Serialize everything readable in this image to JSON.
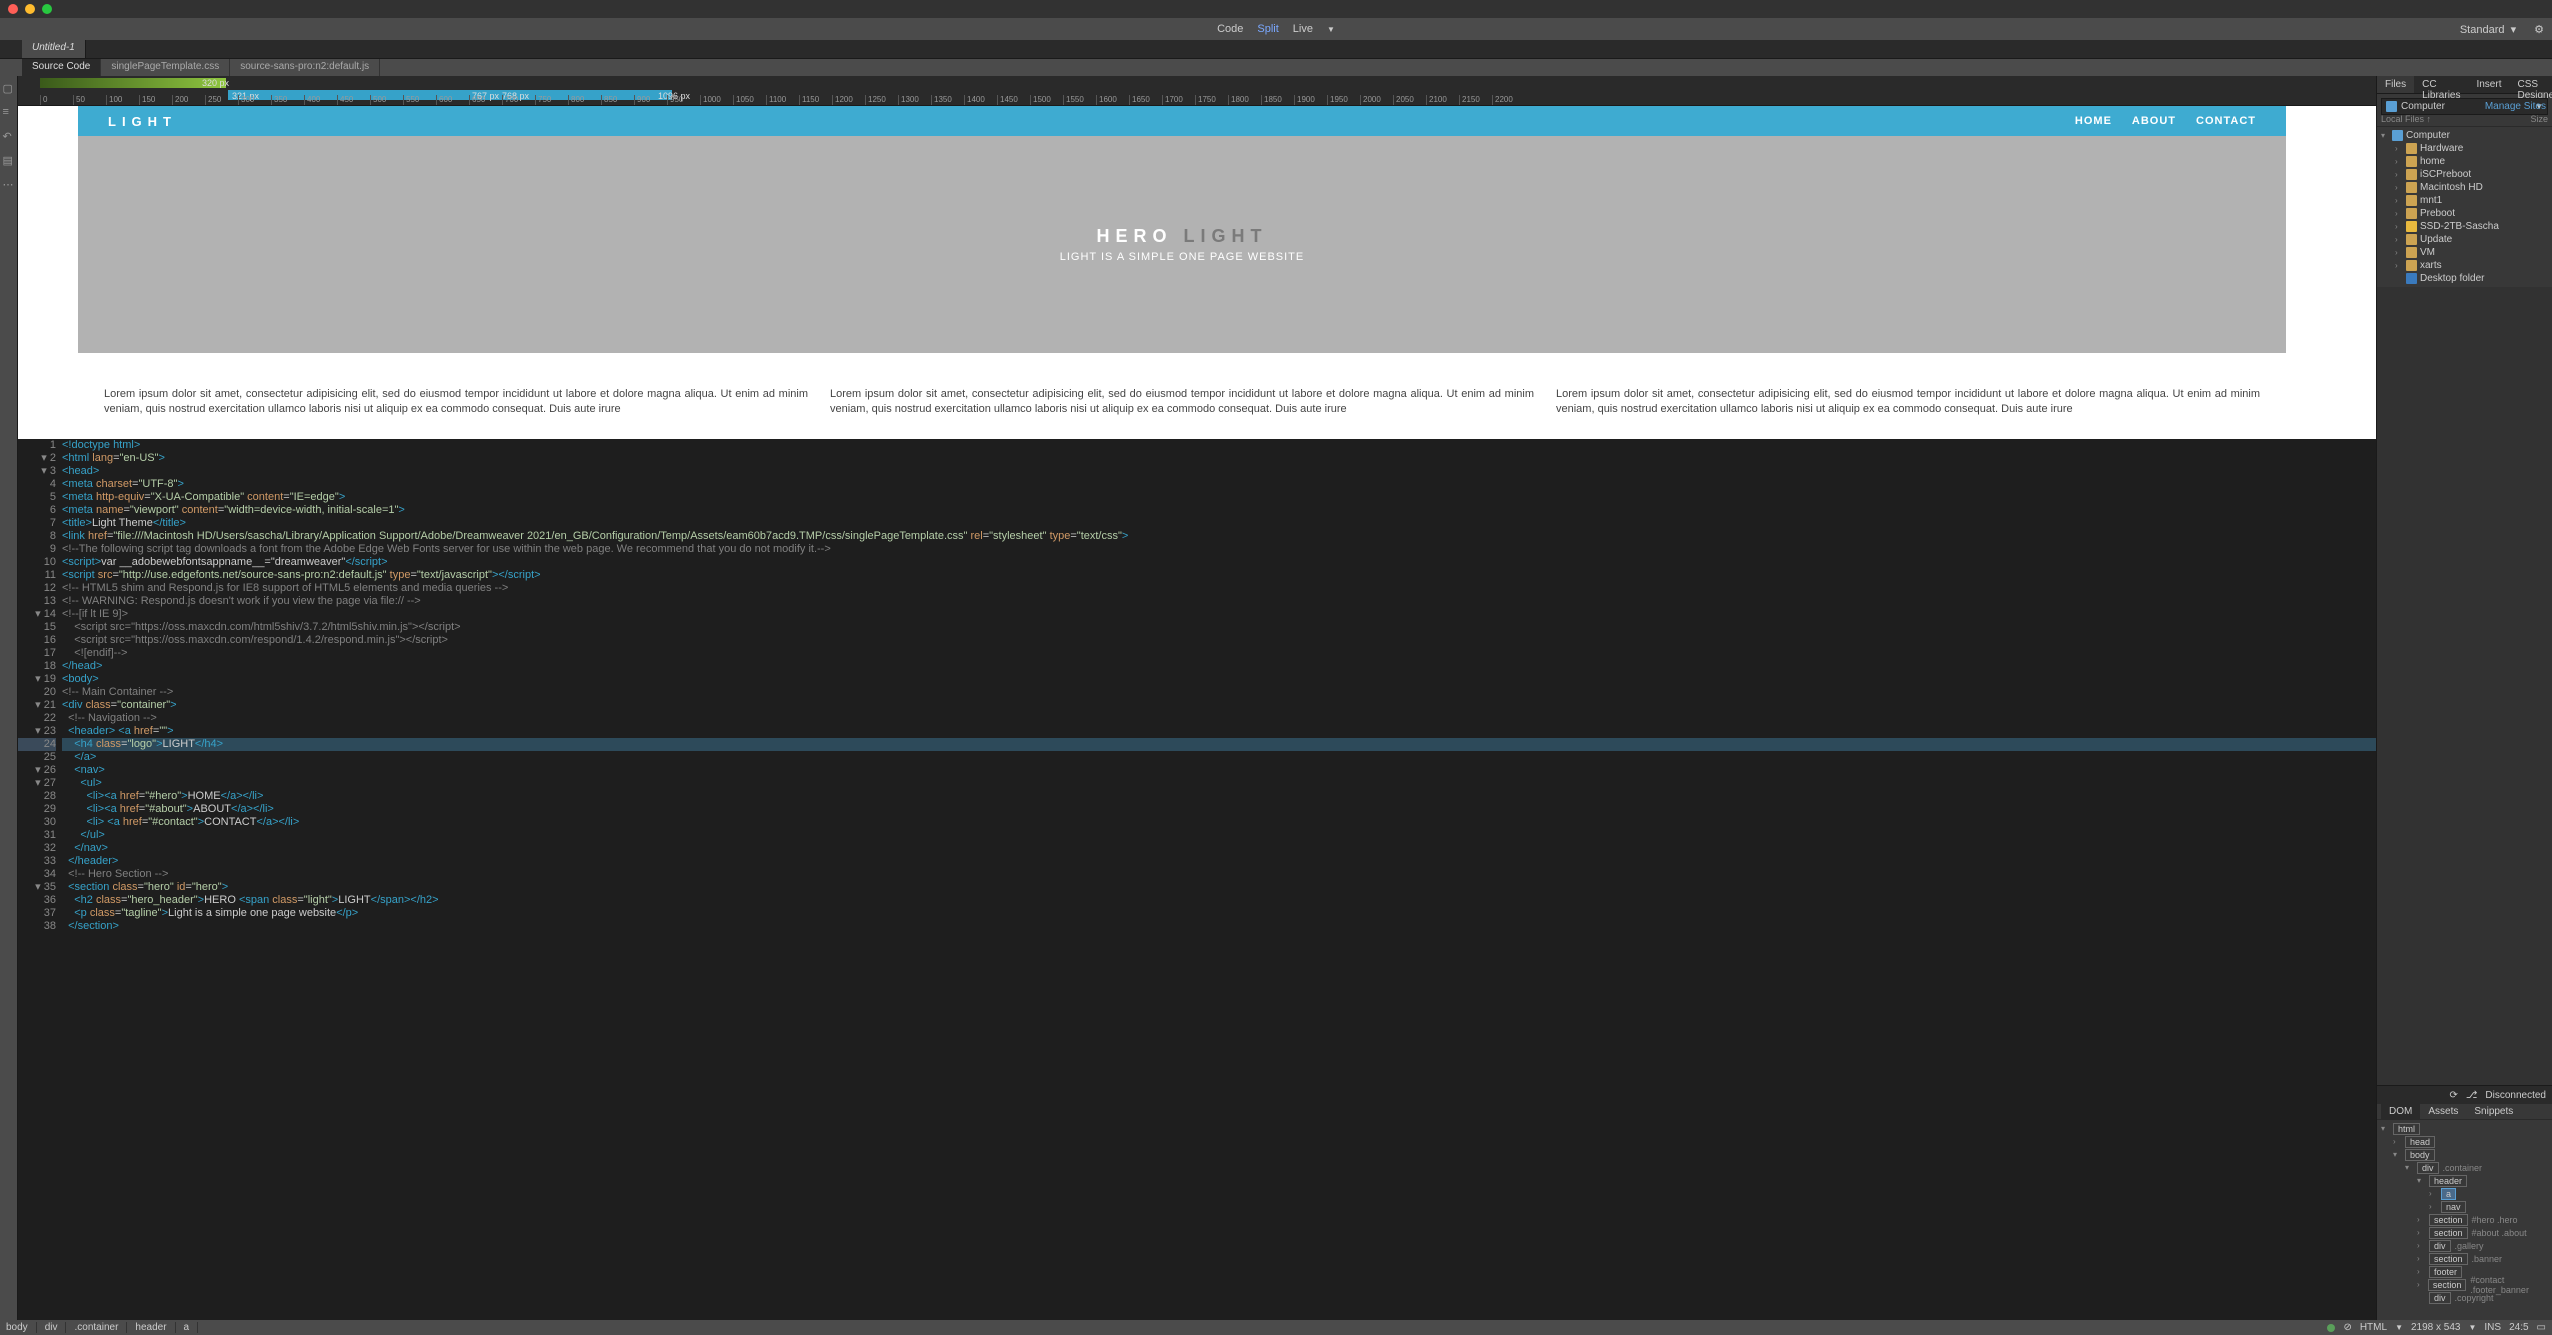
{
  "titlebar": {
    "view_modes": [
      "Code",
      "Split",
      "Live"
    ],
    "active_mode": "Split",
    "layout_label": "Standard"
  },
  "docTabs": [
    "Untitled-1"
  ],
  "fileTabs": [
    "Source Code",
    "singlePageTemplate.css",
    "source-sans-pro:n2:default.js"
  ],
  "rulerStrip": {
    "green_label": "320 px",
    "blue_start": "321 px",
    "blue_labels": [
      "767 px",
      "768 px"
    ],
    "blue_end": "1096 px"
  },
  "ruler_ticks": [
    "0",
    "50",
    "100",
    "150",
    "200",
    "250",
    "300",
    "350",
    "400",
    "450",
    "500",
    "550",
    "600",
    "650",
    "700",
    "750",
    "800",
    "850",
    "900",
    "950",
    "1000",
    "1050",
    "1100",
    "1150",
    "1200",
    "1250",
    "1300",
    "1350",
    "1400",
    "1450",
    "1500",
    "1550",
    "1600",
    "1650",
    "1700",
    "1750",
    "1800",
    "1850",
    "1900",
    "1950",
    "2000",
    "2050",
    "2100",
    "2150",
    "2200"
  ],
  "preview": {
    "logo": "LIGHT",
    "nav": [
      "HOME",
      "ABOUT",
      "CONTACT"
    ],
    "hero_dark": "HERO",
    "hero_light": "LIGHT",
    "tagline": "LIGHT IS A SIMPLE ONE PAGE WEBSITE",
    "lorem": "Lorem ipsum dolor sit amet, consectetur adipisicing elit, sed do eiusmod tempor incididunt ut labore et dolore magna aliqua. Ut enim ad minim veniam, quis nostrud exercitation ullamco laboris nisi ut aliquip ex ea commodo consequat. Duis aute irure"
  },
  "code": [
    {
      "n": 1,
      "f": "",
      "html": "<span class='tag'>&lt;!doctype html&gt;</span>"
    },
    {
      "n": 2,
      "f": "▾",
      "html": "<span class='tag'>&lt;html</span> <span class='attr'>lang</span>=<span class='str'>\"en-US\"</span><span class='tag'>&gt;</span>"
    },
    {
      "n": 3,
      "f": "▾",
      "html": "<span class='tag'>&lt;head&gt;</span>"
    },
    {
      "n": 4,
      "f": "",
      "html": "<span class='tag'>&lt;meta</span> <span class='attr'>charset</span>=<span class='str'>\"UTF-8\"</span><span class='tag'>&gt;</span>"
    },
    {
      "n": 5,
      "f": "",
      "html": "<span class='tag'>&lt;meta</span> <span class='attr'>http-equiv</span>=<span class='str'>\"X-UA-Compatible\"</span> <span class='attr'>content</span>=<span class='str'>\"IE=edge\"</span><span class='tag'>&gt;</span>"
    },
    {
      "n": 6,
      "f": "",
      "html": "<span class='tag'>&lt;meta</span> <span class='attr'>name</span>=<span class='str'>\"viewport\"</span> <span class='attr'>content</span>=<span class='str'>\"width=device-width, initial-scale=1\"</span><span class='tag'>&gt;</span>"
    },
    {
      "n": 7,
      "f": "",
      "html": "<span class='tag'>&lt;title&gt;</span><span class='txt'>Light Theme</span><span class='tag'>&lt;/title&gt;</span>"
    },
    {
      "n": 8,
      "f": "",
      "html": "<span class='tag'>&lt;link</span> <span class='attr'>href</span>=<span class='str'>\"file:///Macintosh HD/Users/sascha/Library/Application Support/Adobe/Dreamweaver 2021/en_GB/Configuration/Temp/Assets/eam60b7acd9.TMP/css/singlePageTemplate.css\"</span> <span class='attr'>rel</span>=<span class='str'>\"stylesheet\"</span> <span class='attr'>type</span>=<span class='str'>\"text/css\"</span><span class='tag'>&gt;</span>"
    },
    {
      "n": 9,
      "f": "",
      "html": "<span class='cmt'>&lt;!--The following script tag downloads a font from the Adobe Edge Web Fonts server for use within the web page. We recommend that you do not modify it.--&gt;</span>"
    },
    {
      "n": 10,
      "f": "",
      "html": "<span class='tag'>&lt;script&gt;</span><span class='txt'>var __adobewebfontsappname__=\"dreamweaver\"</span><span class='tag'>&lt;/script&gt;</span>"
    },
    {
      "n": 11,
      "f": "",
      "html": "<span class='tag'>&lt;script</span> <span class='attr'>src</span>=<span class='str'>\"http://use.edgefonts.net/source-sans-pro:n2:default.js\"</span> <span class='attr'>type</span>=<span class='str'>\"text/javascript\"</span><span class='tag'>&gt;&lt;/script&gt;</span>"
    },
    {
      "n": 12,
      "f": "",
      "html": "<span class='cmt'>&lt;!-- HTML5 shim and Respond.js for IE8 support of HTML5 elements and media queries --&gt;</span>"
    },
    {
      "n": 13,
      "f": "",
      "html": "<span class='cmt'>&lt;!-- WARNING: Respond.js doesn't work if you view the page via file:// --&gt;</span>"
    },
    {
      "n": 14,
      "f": "▾",
      "html": "<span class='cmt'>&lt;!--[if lt IE 9]&gt;</span>"
    },
    {
      "n": 15,
      "f": "",
      "html": "    <span class='cmt'>&lt;script src=\"https://oss.maxcdn.com/html5shiv/3.7.2/html5shiv.min.js\"&gt;&lt;/script&gt;</span>"
    },
    {
      "n": 16,
      "f": "",
      "html": "    <span class='cmt'>&lt;script src=\"https://oss.maxcdn.com/respond/1.4.2/respond.min.js\"&gt;&lt;/script&gt;</span>"
    },
    {
      "n": 17,
      "f": "",
      "html": "    <span class='cmt'>&lt;![endif]--&gt;</span>"
    },
    {
      "n": 18,
      "f": "",
      "html": "<span class='tag'>&lt;/head&gt;</span>"
    },
    {
      "n": 19,
      "f": "▾",
      "html": "<span class='tag'>&lt;body&gt;</span>"
    },
    {
      "n": 20,
      "f": "",
      "html": "<span class='cmt'>&lt;!-- Main Container --&gt;</span>"
    },
    {
      "n": 21,
      "f": "▾",
      "html": "<span class='tag'>&lt;div</span> <span class='attr'>class</span>=<span class='str'>\"container\"</span><span class='tag'>&gt;</span>"
    },
    {
      "n": 22,
      "f": "",
      "html": "  <span class='cmt'>&lt;!-- Navigation --&gt;</span>"
    },
    {
      "n": 23,
      "f": "▾",
      "html": "  <span class='tag'>&lt;header&gt;</span> <span class='tag'>&lt;a</span> <span class='attr'>href</span>=<span class='str'>\"\"</span><span class='tag'>&gt;</span>"
    },
    {
      "n": 24,
      "f": "",
      "hl": true,
      "html": "    <span class='tag'>&lt;h4</span> <span class='attr'>class</span>=<span class='str'>\"logo\"</span><span class='tag'>&gt;</span><span class='txt'>LIGHT</span><span class='tag'>&lt;/h4&gt;</span>"
    },
    {
      "n": 25,
      "f": "",
      "html": "    <span class='tag'>&lt;/a&gt;</span>"
    },
    {
      "n": 26,
      "f": "▾",
      "html": "    <span class='tag'>&lt;nav&gt;</span>"
    },
    {
      "n": 27,
      "f": "▾",
      "html": "      <span class='tag'>&lt;ul&gt;</span>"
    },
    {
      "n": 28,
      "f": "",
      "html": "        <span class='tag'>&lt;li&gt;&lt;a</span> <span class='attr'>href</span>=<span class='str'>\"#hero\"</span><span class='tag'>&gt;</span><span class='txt'>HOME</span><span class='tag'>&lt;/a&gt;&lt;/li&gt;</span>"
    },
    {
      "n": 29,
      "f": "",
      "html": "        <span class='tag'>&lt;li&gt;&lt;a</span> <span class='attr'>href</span>=<span class='str'>\"#about\"</span><span class='tag'>&gt;</span><span class='txt'>ABOUT</span><span class='tag'>&lt;/a&gt;&lt;/li&gt;</span>"
    },
    {
      "n": 30,
      "f": "",
      "html": "        <span class='tag'>&lt;li&gt;</span> <span class='tag'>&lt;a</span> <span class='attr'>href</span>=<span class='str'>\"#contact\"</span><span class='tag'>&gt;</span><span class='txt'>CONTACT</span><span class='tag'>&lt;/a&gt;&lt;/li&gt;</span>"
    },
    {
      "n": 31,
      "f": "",
      "html": "      <span class='tag'>&lt;/ul&gt;</span>"
    },
    {
      "n": 32,
      "f": "",
      "html": "    <span class='tag'>&lt;/nav&gt;</span>"
    },
    {
      "n": 33,
      "f": "",
      "html": "  <span class='tag'>&lt;/header&gt;</span>"
    },
    {
      "n": 34,
      "f": "",
      "html": "  <span class='cmt'>&lt;!-- Hero Section --&gt;</span>"
    },
    {
      "n": 35,
      "f": "▾",
      "html": "  <span class='tag'>&lt;section</span> <span class='attr'>class</span>=<span class='str'>\"hero\"</span> <span class='attr'>id</span>=<span class='str'>\"hero\"</span><span class='tag'>&gt;</span>"
    },
    {
      "n": 36,
      "f": "",
      "html": "    <span class='tag'>&lt;h2</span> <span class='attr'>class</span>=<span class='str'>\"hero_header\"</span><span class='tag'>&gt;</span><span class='txt'>HERO </span><span class='tag'>&lt;span</span> <span class='attr'>class</span>=<span class='str'>\"light\"</span><span class='tag'>&gt;</span><span class='txt'>LIGHT</span><span class='tag'>&lt;/span&gt;&lt;/h2&gt;</span>"
    },
    {
      "n": 37,
      "f": "",
      "html": "    <span class='tag'>&lt;p</span> <span class='attr'>class</span>=<span class='str'>\"tagline\"</span><span class='tag'>&gt;</span><span class='txt'>Light is a simple one page website</span><span class='tag'>&lt;/p&gt;</span>"
    },
    {
      "n": 38,
      "f": "",
      "html": "  <span class='tag'>&lt;/section&gt;</span>"
    }
  ],
  "filesPanel": {
    "tabs": [
      "Files",
      "CC Libraries",
      "Insert",
      "CSS Designer"
    ],
    "dropdown": "Computer",
    "manage_link": "Manage Sites",
    "header_cols": [
      "Local Files ↑",
      "Size"
    ],
    "tree": [
      {
        "indent": 0,
        "arrow": "▾",
        "icon": "fi-comp",
        "label": "Computer"
      },
      {
        "indent": 1,
        "arrow": "›",
        "icon": "fi-fold",
        "label": "Hardware"
      },
      {
        "indent": 1,
        "arrow": "›",
        "icon": "fi-fold",
        "label": "home"
      },
      {
        "indent": 1,
        "arrow": "›",
        "icon": "fi-fold",
        "label": "iSCPreboot"
      },
      {
        "indent": 1,
        "arrow": "›",
        "icon": "fi-fold",
        "label": "Macintosh HD"
      },
      {
        "indent": 1,
        "arrow": "›",
        "icon": "fi-fold",
        "label": "mnt1"
      },
      {
        "indent": 1,
        "arrow": "›",
        "icon": "fi-fold",
        "label": "Preboot"
      },
      {
        "indent": 1,
        "arrow": "›",
        "icon": "fi-fold-y",
        "label": "SSD-2TB-Sascha"
      },
      {
        "indent": 1,
        "arrow": "›",
        "icon": "fi-fold",
        "label": "Update"
      },
      {
        "indent": 1,
        "arrow": "›",
        "icon": "fi-fold",
        "label": "VM"
      },
      {
        "indent": 1,
        "arrow": "›",
        "icon": "fi-fold",
        "label": "xarts"
      },
      {
        "indent": 1,
        "arrow": "",
        "icon": "fi-desk",
        "label": "Desktop folder"
      }
    ]
  },
  "domPanel": {
    "status": "Disconnected",
    "tabs": [
      "DOM",
      "Assets",
      "Snippets"
    ],
    "tree": [
      {
        "indent": 0,
        "arrow": "▾",
        "sel": false,
        "tag": "html",
        "cls": ""
      },
      {
        "indent": 1,
        "arrow": "›",
        "sel": false,
        "tag": "head",
        "cls": ""
      },
      {
        "indent": 1,
        "arrow": "▾",
        "sel": false,
        "tag": "body",
        "cls": ""
      },
      {
        "indent": 2,
        "arrow": "▾",
        "sel": false,
        "tag": "div",
        "cls": ".container"
      },
      {
        "indent": 3,
        "arrow": "▾",
        "sel": false,
        "tag": "header",
        "cls": ""
      },
      {
        "indent": 4,
        "arrow": "›",
        "sel": true,
        "tag": "a",
        "cls": ""
      },
      {
        "indent": 4,
        "arrow": "›",
        "sel": false,
        "tag": "nav",
        "cls": ""
      },
      {
        "indent": 3,
        "arrow": "›",
        "sel": false,
        "tag": "section",
        "cls": "#hero .hero"
      },
      {
        "indent": 3,
        "arrow": "›",
        "sel": false,
        "tag": "section",
        "cls": "#about .about"
      },
      {
        "indent": 3,
        "arrow": "›",
        "sel": false,
        "tag": "div",
        "cls": ".gallery"
      },
      {
        "indent": 3,
        "arrow": "›",
        "sel": false,
        "tag": "section",
        "cls": ".banner"
      },
      {
        "indent": 3,
        "arrow": "›",
        "sel": false,
        "tag": "footer",
        "cls": ""
      },
      {
        "indent": 3,
        "arrow": "›",
        "sel": false,
        "tag": "section",
        "cls": "#contact .footer_banner"
      },
      {
        "indent": 3,
        "arrow": "",
        "sel": false,
        "tag": "div",
        "cls": ".copyright"
      }
    ]
  },
  "footer": {
    "crumbs": [
      "body",
      "div",
      ".container",
      "header",
      "a"
    ],
    "lang": "HTML",
    "size": "2198 x 543",
    "ins": "INS",
    "pos": "24:5"
  }
}
